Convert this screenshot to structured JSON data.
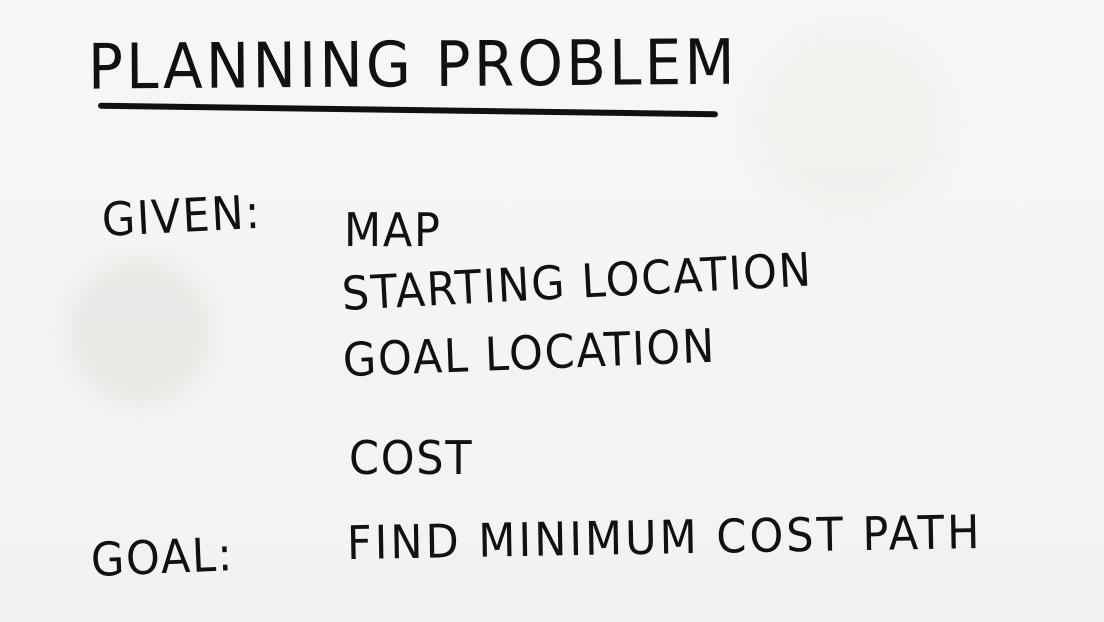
{
  "slide": {
    "title": "PLANNING PROBLEM",
    "given_label": "GIVEN:",
    "given_items": [
      "MAP",
      "STARTING LOCATION",
      "GOAL LOCATION",
      "COST"
    ],
    "goal_label": "GOAL:",
    "goal_text": "FIND MINIMUM COST PATH"
  }
}
